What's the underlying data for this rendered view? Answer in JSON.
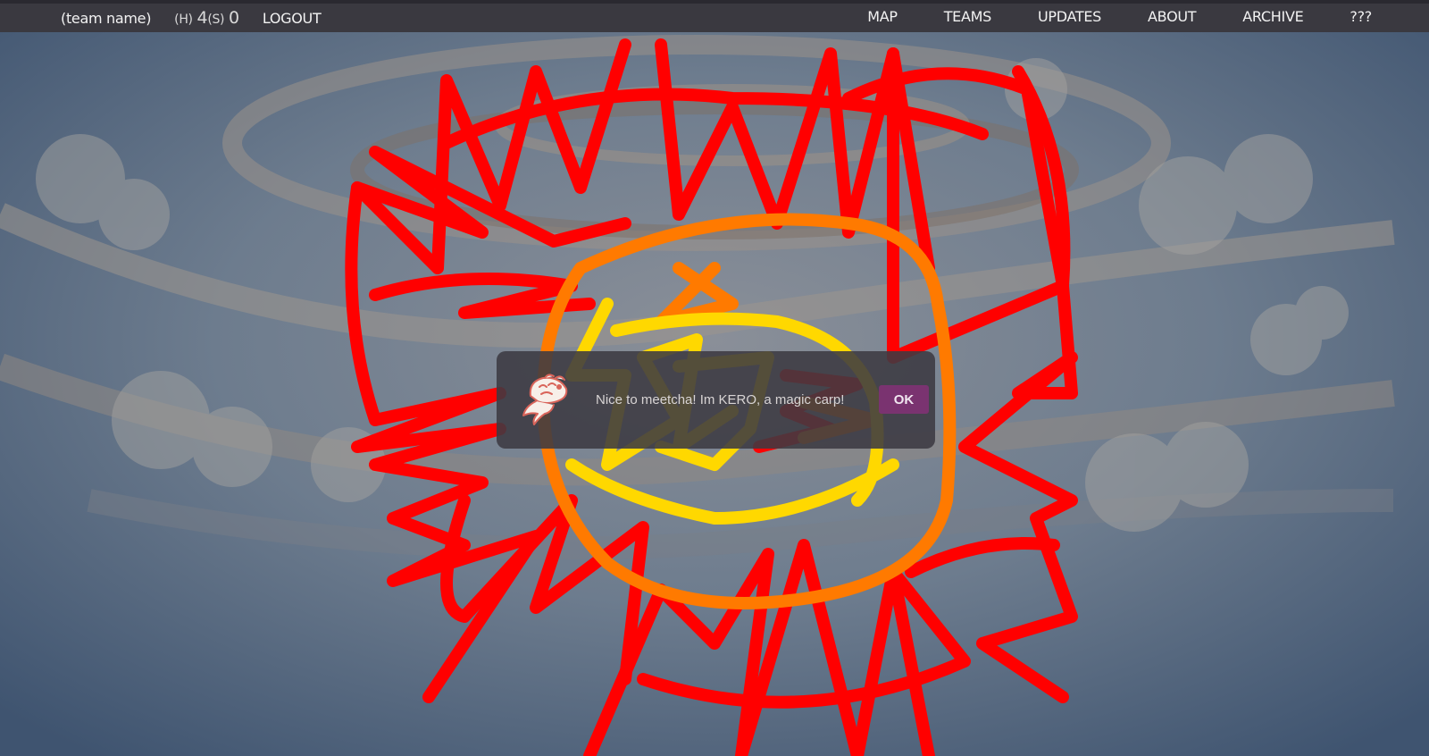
{
  "nav": {
    "team_name": "(team name)",
    "score_h_label": "(H)",
    "score_h_value": "4",
    "score_s_label": "(S)",
    "score_s_value": "0",
    "logout": "LOGOUT",
    "links": [
      "MAP",
      "TEAMS",
      "UPDATES",
      "ABOUT",
      "ARCHIVE",
      "???"
    ]
  },
  "dialog": {
    "icon": "carp-icon",
    "message": "Nice to meetcha! Im KERO, a magic carp!",
    "ok_label": "OK"
  },
  "colors": {
    "navbar": "#3a3940",
    "dialog_bg": "#3c3a42",
    "ok_button": "#7a3370",
    "scribble_red": "#ff0000",
    "scribble_orange": "#ff7a00",
    "scribble_yellow": "#ffd800"
  }
}
